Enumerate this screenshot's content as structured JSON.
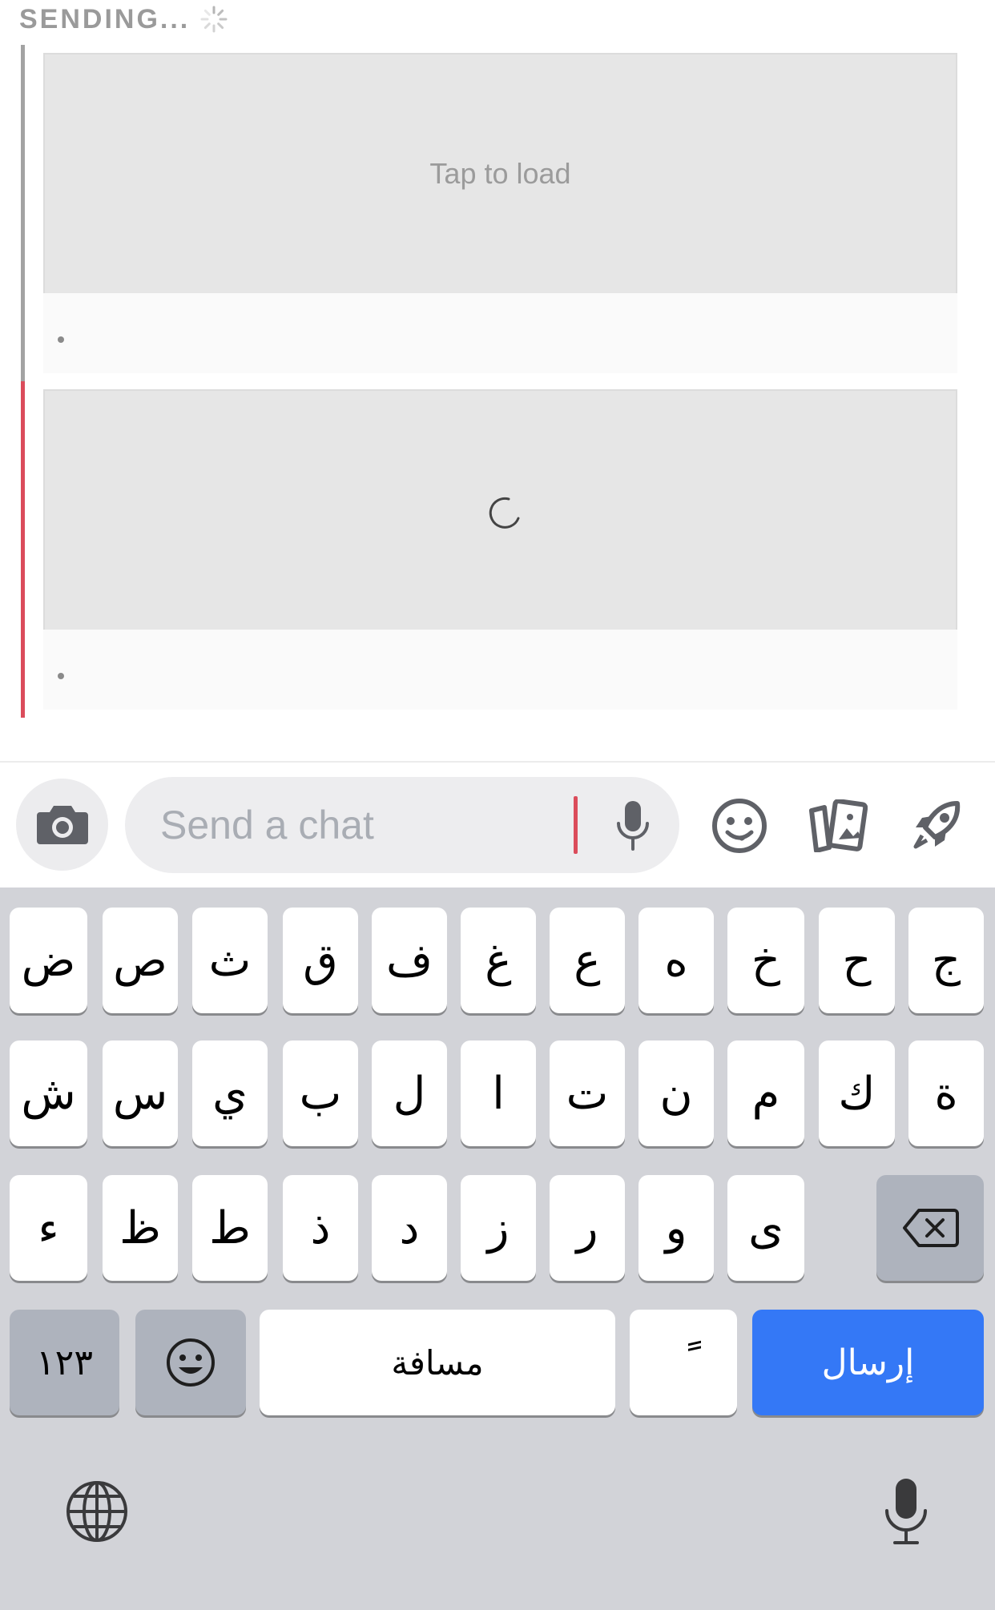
{
  "status": {
    "sending_label": "SENDING..."
  },
  "messages": [
    {
      "load_label": "Tap to load",
      "caption": "."
    },
    {
      "loading": true,
      "caption": "."
    }
  ],
  "input_bar": {
    "placeholder": "Send a chat"
  },
  "keyboard": {
    "rows": [
      [
        "ض",
        "ص",
        "ث",
        "ق",
        "ف",
        "غ",
        "ع",
        "ه",
        "خ",
        "ح",
        "ج"
      ],
      [
        "ش",
        "س",
        "ي",
        "ب",
        "ل",
        "ا",
        "ت",
        "ن",
        "م",
        "ك",
        "ة"
      ],
      [
        "ء",
        "ظ",
        "ط",
        "ذ",
        "د",
        "ز",
        "ر",
        "و",
        "ى"
      ]
    ],
    "numbers_label": "١٢٣",
    "space_label": "مسافة",
    "diacritic_label": "ً",
    "send_label": "إرسال"
  },
  "colors": {
    "accent_red": "#db4c5b",
    "send_blue": "#3478f6",
    "keyboard_bg": "#d2d3d8"
  }
}
